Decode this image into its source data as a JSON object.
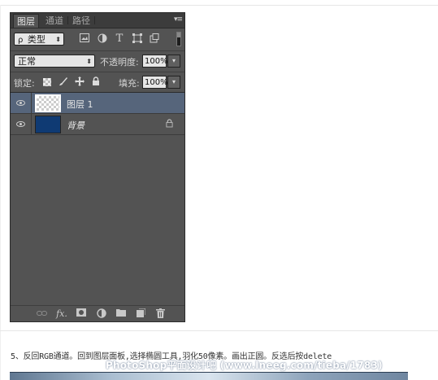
{
  "panel": {
    "tabs": [
      "图层",
      "通道",
      "路径"
    ],
    "menu_glyph": "▾≡",
    "filter": {
      "kind_label": "类型",
      "search_glyph": "ρ",
      "icons": [
        "image-filter-icon",
        "adjustment-filter-icon",
        "type-filter-icon",
        "shape-filter-icon",
        "smart-object-filter-icon"
      ]
    },
    "blend": {
      "mode": "正常",
      "opacity_label": "不透明度:",
      "opacity_value": "100%"
    },
    "lock": {
      "label": "锁定:",
      "fill_label": "填充:",
      "fill_value": "100%"
    },
    "layers": [
      {
        "name": "图层 1",
        "selected": true,
        "visible": true,
        "thumb": "transparent"
      },
      {
        "name": "背景",
        "selected": false,
        "visible": true,
        "thumb": "#0f3a73",
        "locked": true
      }
    ],
    "footer_icons": [
      "link-icon",
      "fx-icon",
      "mask-icon",
      "adjustment-icon",
      "group-folder-icon",
      "new-layer-icon",
      "trash-icon"
    ]
  },
  "content": {
    "step_text": "5、反回RGB通道。回到图层面板,选择椭圆工具,羽化50像素。画出正圆。反选后按delete",
    "watermark": "PhotoShop平面设计吧 (www.lneeg.com/tieba/1783)"
  },
  "colors": {
    "panel_bg": "#535353",
    "selected_row": "#56657b",
    "background_layer_fill": "#0f3a73"
  }
}
